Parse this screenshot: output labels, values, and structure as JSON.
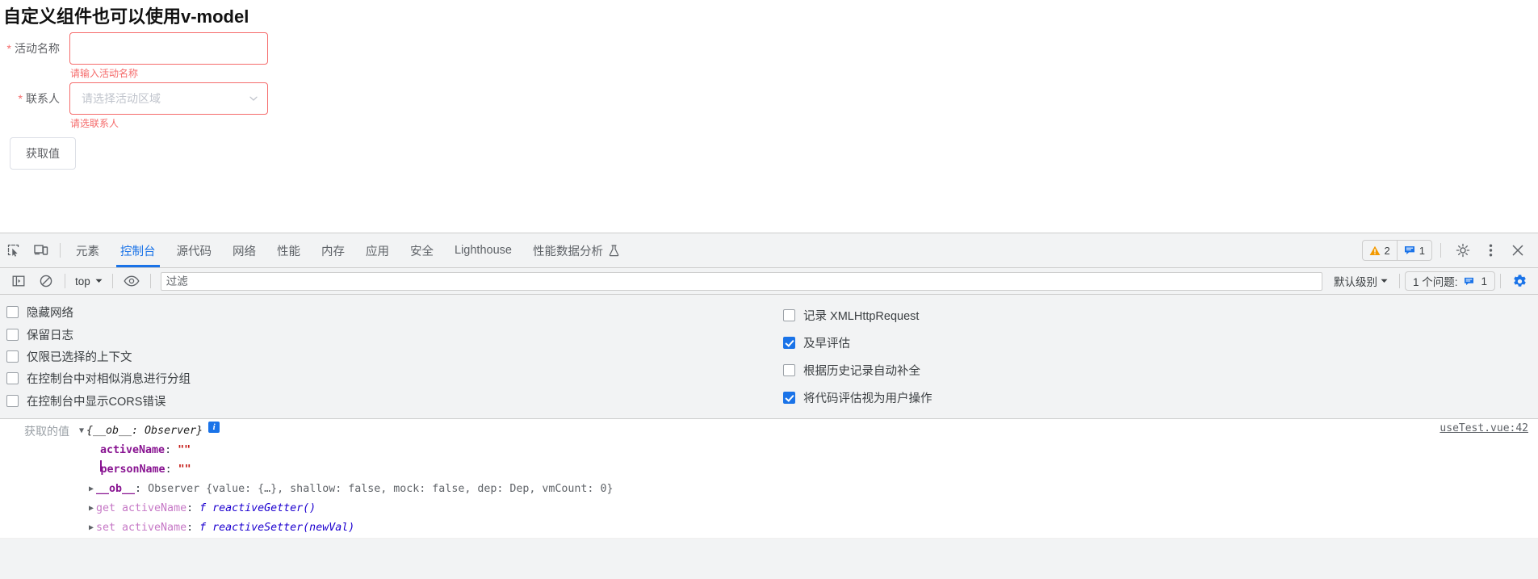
{
  "page": {
    "title": "自定义组件也可以使用v-model",
    "form": {
      "fields": [
        {
          "label": "活动名称",
          "required_mark": "*",
          "type": "input",
          "value": "",
          "placeholder": "",
          "error": "请输入活动名称"
        },
        {
          "label": "联系人",
          "required_mark": "*",
          "type": "select",
          "value": "",
          "placeholder": "请选择活动区域",
          "error": "请选联系人"
        }
      ],
      "submit_label": "获取值"
    }
  },
  "devtools": {
    "tabs": [
      {
        "label": "元素",
        "selected": false
      },
      {
        "label": "控制台",
        "selected": true
      },
      {
        "label": "源代码",
        "selected": false
      },
      {
        "label": "网络",
        "selected": false
      },
      {
        "label": "性能",
        "selected": false
      },
      {
        "label": "内存",
        "selected": false
      },
      {
        "label": "应用",
        "selected": false
      },
      {
        "label": "安全",
        "selected": false
      },
      {
        "label": "Lighthouse",
        "selected": false
      },
      {
        "label": "性能数据分析",
        "selected": false,
        "icon": "flask-icon"
      }
    ],
    "tabbar_icons": {
      "inspect": "inspect-element-icon",
      "device": "device-toolbar-icon"
    },
    "counters": {
      "warning_count": "2",
      "message_count": "1"
    },
    "actions": {
      "settings": "gear-icon",
      "more": "kebab-menu-icon",
      "close": "close-icon"
    },
    "filterbar": {
      "sidebar_toggle": "console-sidebar-icon",
      "clear": "clear-console-icon",
      "context": "top",
      "eye": "live-expression-icon",
      "filter_placeholder": "过滤",
      "filter_value": "",
      "level": "默认级别",
      "issues_label": "1 个问题:",
      "issues_count": "1",
      "issues_icon": "message-icon",
      "settings_gear": "console-settings-gear-icon"
    },
    "settings": {
      "left": [
        {
          "label": "隐藏网络",
          "checked": false
        },
        {
          "label": "保留日志",
          "checked": false
        },
        {
          "label": "仅限已选择的上下文",
          "checked": false
        },
        {
          "label": "在控制台中对相似消息进行分组",
          "checked": false
        },
        {
          "label": "在控制台中显示CORS错误",
          "checked": false
        }
      ],
      "right": [
        {
          "label": "记录 XMLHttpRequest",
          "checked": false
        },
        {
          "label": "及早评估",
          "checked": true
        },
        {
          "label": "根据历史记录自动补全",
          "checked": false
        },
        {
          "label": "将代码评估视为用户操作",
          "checked": true
        }
      ]
    },
    "console": {
      "log_label": "获取的值",
      "object_summary": "{__ob__: Observer}",
      "info_badge": "i",
      "source": "useTest.vue:42",
      "properties": [
        {
          "kind": "own",
          "name": "activeName",
          "sep": ": ",
          "value": "\"\"",
          "expandable": false
        },
        {
          "kind": "own",
          "name": "personName",
          "sep": ": ",
          "value": "\"\"",
          "expandable": false,
          "cursor": true
        },
        {
          "kind": "internal",
          "name": "__ob__",
          "sep": ": ",
          "value": "Observer {value: {…}, shallow: false, mock: false, dep: Dep, vmCount: 0}",
          "expandable": true
        },
        {
          "kind": "accessor",
          "name": "get activeName",
          "sep": ": ",
          "value": "f reactiveGetter()",
          "expandable": true
        },
        {
          "kind": "accessor",
          "name": "set activeName",
          "sep": ": ",
          "value": "f reactiveSetter(newVal)",
          "expandable": true
        }
      ]
    }
  },
  "colors": {
    "accent": "#1a73e8",
    "error": "#f56c6c",
    "warning": "#f29900",
    "toolbar_bg": "#f2f3f4"
  }
}
